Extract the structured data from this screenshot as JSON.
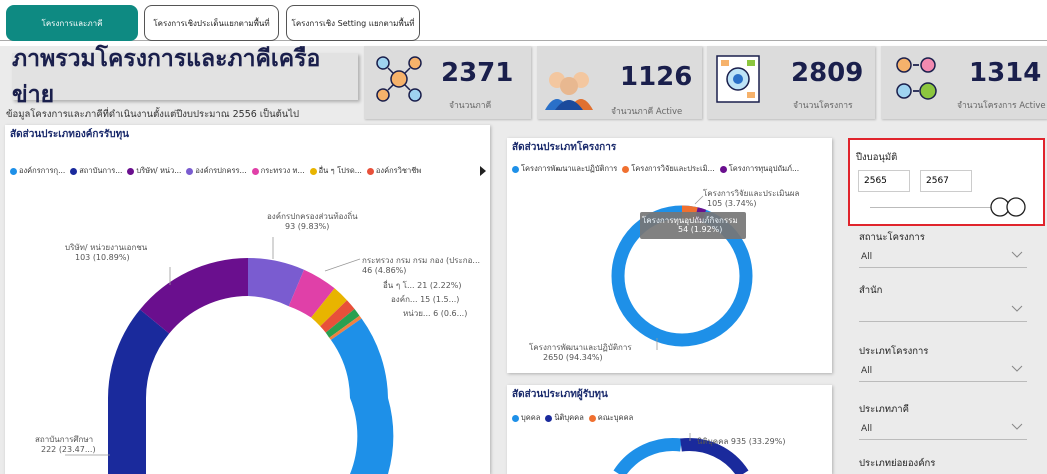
{
  "tabs": [
    {
      "label": "โครงการและภาคี",
      "active": true
    },
    {
      "label": "โครงการเชิงประเด็นแยกตามพื้นที่",
      "active": false
    },
    {
      "label": "โครงการเชิง Setting แยกตามพื้นที่",
      "active": false
    }
  ],
  "header": {
    "title": "ภาพรวมโครงการและภาคีเครือข่าย",
    "subtitle": "ข้อมูลโครงการและภาคีที่ดำเนินงานตั้งแต่ปีงบประมาณ 2556 เป็นต้นไป"
  },
  "stats": [
    {
      "value": "2371",
      "label": "จำนวนภาคี",
      "icon": "network-people-icon"
    },
    {
      "value": "1126",
      "label": "จำนวนภาคี Active",
      "icon": "team-people-icon"
    },
    {
      "value": "2809",
      "label": "จำนวนโครงการ",
      "icon": "vision-board-icon"
    },
    {
      "value": "1314",
      "label": "จำนวนโครงการ Active",
      "icon": "exchange-people-icon"
    }
  ],
  "colors": {
    "teal": "#0e8a82",
    "navy": "#1a1f4c",
    "blue": "#2196f3",
    "darkblue": "#1a2a9c",
    "purple": "#6a0f8e",
    "orange": "#f07030",
    "highlight": "#e0242c"
  },
  "panel_funding_org": {
    "title": "สัดส่วนประเภทองค์กรรับทุน",
    "legend": [
      "องค์กรการกุ...",
      "สถาบันการ...",
      "บริษัท/ หน่ว...",
      "องค์กรปกครร...",
      "กระทรวง ท...",
      "อื่น ๆ โปรด...",
      "องค์กรวิชาชีพ"
    ],
    "legend_colors": [
      "#1e90e8",
      "#1a2a9c",
      "#6a0f8e",
      "#7a5cd0",
      "#e040a8",
      "#e8b400",
      "#e8503a"
    ],
    "annotations": {
      "local": "องค์กรปกครองส่วนท้องถิ่น",
      "local_val": "93 (9.83%)",
      "company": "บริษัท/ หน่วยงานเอกชน",
      "company_val": "103 (10.89%)",
      "ministry": "กระทรวง กรม กรม กอง (ประกอ...",
      "ministry_val": "46 (4.86%)",
      "other": "อื่น ๆ โ... 21 (2.22%)",
      "org": "องค์ก... 15 (1.5...)",
      "unit": "หน่วย... 6 (0.6...)",
      "edu": "สถาบันการศึกษา",
      "edu_val": "222 (23.47...)"
    }
  },
  "panel_project_type": {
    "title": "สัดส่วนประเภทโครงการ",
    "legend": [
      "โครงการพัฒนาและปฏิบัติการ",
      "โครงการวิจัยและประเมิ...",
      "โครงการทุนอุปถัมภ์..."
    ],
    "legend_colors": [
      "#1e90e8",
      "#f07030",
      "#6a0f8e"
    ],
    "annotations": {
      "research": "โครงการวิจัยและประเมินผล",
      "research_val": "105 (3.74%)",
      "tooltip_title": "โครงการทุนอุปถัมภ์กิจกรรม",
      "tooltip_val": "54 (1.92%)",
      "dev": "โครงการพัฒนาและปฏิบัติการ",
      "dev_val": "2650 (94.34%)"
    }
  },
  "panel_recipient": {
    "title": "สัดส่วนประเภทผู้รับทุน",
    "legend": [
      "บุคคล",
      "นิติบุคคล",
      "คณะบุคคล"
    ],
    "legend_colors": [
      "#1e90e8",
      "#1a2a9c",
      "#f07030"
    ],
    "annotation": "นิติบุคคล 935 (33.29%)"
  },
  "filters": {
    "year_label": "ปีงบอนุมัติ",
    "year_from": "2565",
    "year_to": "2567",
    "status_label": "สถานะโครงการ",
    "status_value": "All",
    "office_label": "สำนัก",
    "office_value": "",
    "project_type_label": "ประเภทโครงการ",
    "project_type_value": "All",
    "partner_type_label": "ประเภทภาคี",
    "partner_type_value": "All",
    "suborg_label": "ประเภทย่อยองค์กร"
  }
}
